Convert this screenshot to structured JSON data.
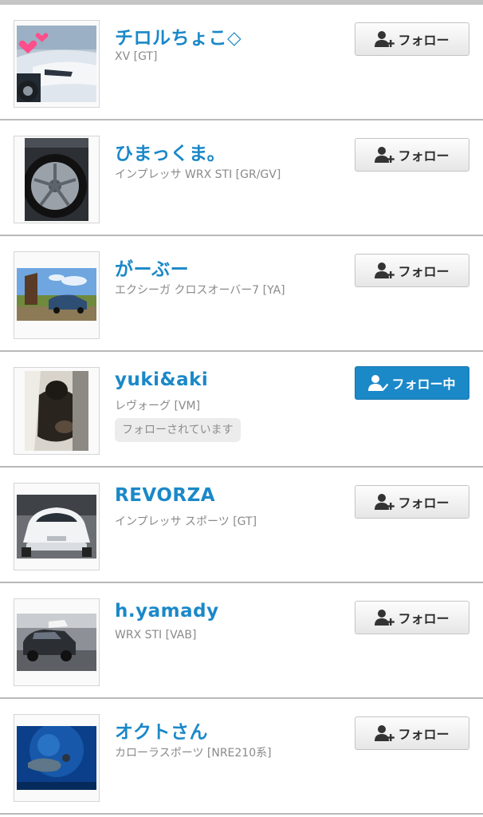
{
  "colors": {
    "accent": "#1b88c8",
    "following_button_bg": "#1b88c8",
    "divider": "#b9b9b9"
  },
  "icons": {
    "follow": "user-plus-icon",
    "following": "user-check-icon"
  },
  "users": [
    {
      "name": "チロルちょこ◇",
      "car": "XV [GT]",
      "button_label": "フォロー",
      "following": false
    },
    {
      "name": "ひまっくま。",
      "car": "インプレッサ WRX STI [GR/GV]",
      "button_label": "フォロー",
      "following": false
    },
    {
      "name": "がーぶー",
      "car": "エクシーガ クロスオーバー7 [YA]",
      "button_label": "フォロー",
      "following": false
    },
    {
      "name": "yuki&aki",
      "car": "レヴォーグ [VM]",
      "button_label": "フォロー中",
      "following": true,
      "badge": "フォローされています"
    },
    {
      "name": "REVORZA",
      "car": "インプレッサ スポーツ [GT]",
      "button_label": "フォロー",
      "following": false
    },
    {
      "name": "h.yamady",
      "car": "WRX STI [VAB]",
      "button_label": "フォロー",
      "following": false
    },
    {
      "name": "オクトさん",
      "car": "カローラスポーツ [NRE210系]",
      "button_label": "フォロー",
      "following": false
    }
  ]
}
